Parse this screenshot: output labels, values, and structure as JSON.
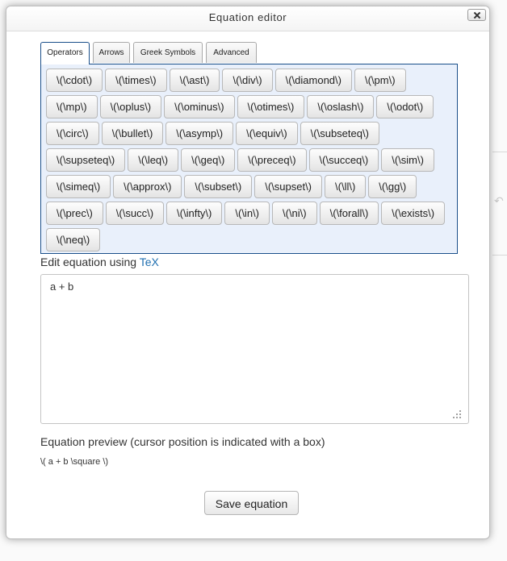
{
  "dialog": {
    "title": "Equation editor"
  },
  "tabs": [
    {
      "label": "Operators",
      "active": true
    },
    {
      "label": "Arrows",
      "active": false
    },
    {
      "label": "Greek Symbols",
      "active": false
    },
    {
      "label": "Advanced",
      "active": false
    }
  ],
  "operators": [
    "\\(\\cdot\\)",
    "\\(\\times\\)",
    "\\(\\ast\\)",
    "\\(\\div\\)",
    "\\(\\diamond\\)",
    "\\(\\pm\\)",
    "\\(\\mp\\)",
    "\\(\\oplus\\)",
    "\\(\\ominus\\)",
    "\\(\\otimes\\)",
    "\\(\\oslash\\)",
    "\\(\\odot\\)",
    "\\(\\circ\\)",
    "\\(\\bullet\\)",
    "\\(\\asymp\\)",
    "\\(\\equiv\\)",
    "\\(\\subseteq\\)",
    "\\(\\supseteq\\)",
    "\\(\\leq\\)",
    "\\(\\geq\\)",
    "\\(\\preceq\\)",
    "\\(\\succeq\\)",
    "\\(\\sim\\)",
    "\\(\\simeq\\)",
    "\\(\\approx\\)",
    "\\(\\subset\\)",
    "\\(\\supset\\)",
    "\\(\\ll\\)",
    "\\(\\gg\\)",
    "\\(\\prec\\)",
    "\\(\\succ\\)",
    "\\(\\infty\\)",
    "\\(\\in\\)",
    "\\(\\ni\\)",
    "\\(\\forall\\)",
    "\\(\\exists\\)",
    "\\(\\neq\\)"
  ],
  "edit": {
    "label": "Edit equation using ",
    "link": "TeX",
    "value": "a + b"
  },
  "preview": {
    "label": "Equation preview (cursor position is indicated with a box)",
    "text": "\\( a + b \\square \\)"
  },
  "save_label": "Save equation",
  "colors": {
    "accent": "#1a4f8a",
    "panel_bg": "#e9f0fb",
    "link": "#1f6fb0"
  }
}
